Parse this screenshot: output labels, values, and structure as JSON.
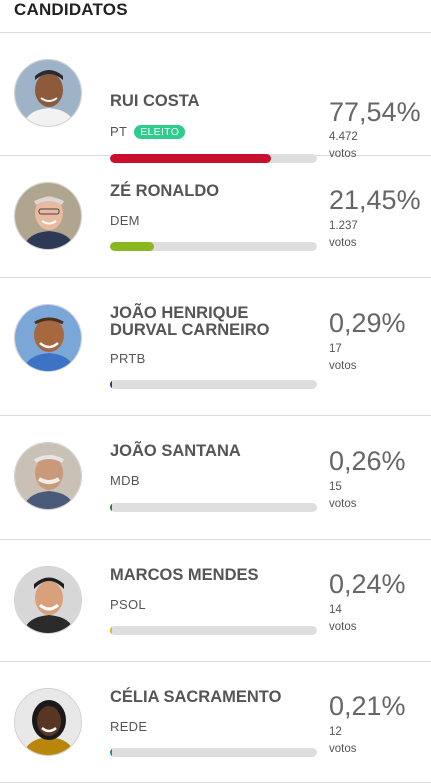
{
  "header": {
    "title": "CANDIDATOS"
  },
  "colors": {
    "bar_track": "#dedede",
    "elected_badge": "#2fcc8b"
  },
  "candidates": [
    {
      "name": "RUI COSTA",
      "party": "PT",
      "badge": "ELEITO",
      "percent": "77,54%",
      "share": 0.7754,
      "votes_count": "4.472",
      "votes_label": "votos",
      "bar_color": "#c8102e",
      "avatar_icon": "candidate-photo"
    },
    {
      "name": "ZÉ RONALDO",
      "party": "DEM",
      "badge": "",
      "percent": "21,45%",
      "share": 0.2145,
      "votes_count": "1.237",
      "votes_label": "votos",
      "bar_color": "#8ab720",
      "avatar_icon": "candidate-photo"
    },
    {
      "name": "JOÃO HENRIQUE DURVAL CARNEIRO",
      "party": "PRTB",
      "badge": "",
      "percent": "0,29%",
      "share": 0.0029,
      "votes_count": "17",
      "votes_label": "votos",
      "bar_color": "#1e3a8a",
      "avatar_icon": "candidate-photo"
    },
    {
      "name": "JOÃO SANTANA",
      "party": "MDB",
      "badge": "",
      "percent": "0,26%",
      "share": 0.0026,
      "votes_count": "15",
      "votes_label": "votos",
      "bar_color": "#2e7d32",
      "avatar_icon": "candidate-photo"
    },
    {
      "name": "MARCOS MENDES",
      "party": "PSOL",
      "badge": "",
      "percent": "0,24%",
      "share": 0.0024,
      "votes_count": "14",
      "votes_label": "votos",
      "bar_color": "#f4b400",
      "avatar_icon": "candidate-photo"
    },
    {
      "name": "CÉLIA SACRAMENTO",
      "party": "REDE",
      "badge": "",
      "percent": "0,21%",
      "share": 0.0021,
      "votes_count": "12",
      "votes_label": "votos",
      "bar_color": "#1e88a8",
      "avatar_icon": "candidate-photo"
    }
  ]
}
